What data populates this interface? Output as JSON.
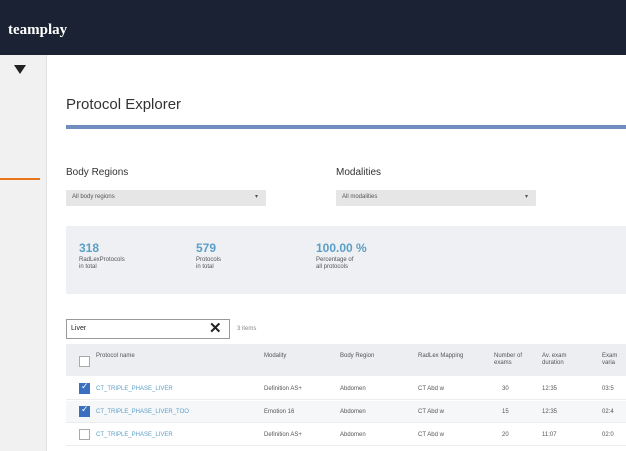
{
  "app": {
    "brand": "teamplay"
  },
  "page": {
    "title": "Protocol Explorer"
  },
  "filters": {
    "body_regions": {
      "label": "Body Regions",
      "value": "All body regions"
    },
    "modalities": {
      "label": "Modalities",
      "value": "All modalities"
    }
  },
  "stats": [
    {
      "value": "318",
      "line1": "RadLexProtocols",
      "line2": "in total"
    },
    {
      "value": "579",
      "line1": "Protocols",
      "line2": "in total"
    },
    {
      "value": "100.00 %",
      "line1": "Percentage of",
      "line2": "all protocols"
    }
  ],
  "search": {
    "value": "Liver",
    "count": "3 items"
  },
  "table": {
    "headers": [
      {
        "l1": "Protocol name",
        "l2": ""
      },
      {
        "l1": "Modality",
        "l2": ""
      },
      {
        "l1": "Body Region",
        "l2": ""
      },
      {
        "l1": "RadLex Mapping",
        "l2": ""
      },
      {
        "l1": "Number of",
        "l2": "exams"
      },
      {
        "l1": "Av. exam",
        "l2": "duration"
      },
      {
        "l1": "Exam",
        "l2": "varia"
      }
    ],
    "rows": [
      {
        "checked": true,
        "cells": [
          "CT_TRIPLE_PHASE_LIVER",
          "Definition AS+",
          "Abdomen",
          "CT Abd w",
          "30",
          "12:35",
          "03:5"
        ]
      },
      {
        "checked": true,
        "cells": [
          "CT_TRIPLE_PHASE_LIVER_TOO",
          "Emotion 16",
          "Abdomen",
          "CT Abd w",
          "15",
          "12:35",
          "02:4"
        ]
      },
      {
        "checked": false,
        "cells": [
          "CT_TRIPLE_PHASE_LIVER",
          "Definition AS+",
          "Abdomen",
          "CT Abd w",
          "20",
          "11:07",
          "02:0"
        ]
      }
    ]
  }
}
